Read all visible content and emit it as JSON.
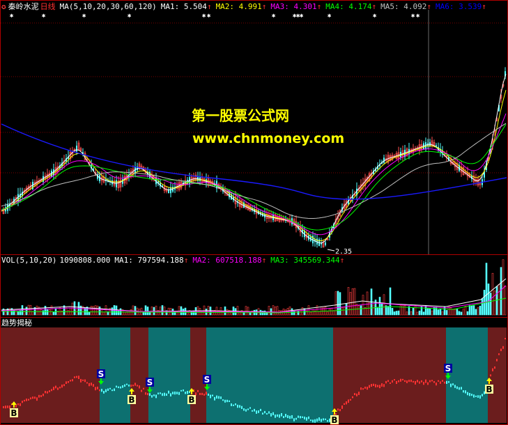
{
  "main": {
    "stock": "秦岭水泥",
    "period": "日线",
    "ma_label": "MA(5,10,20,30,60,120)",
    "values": [
      {
        "label": "MA1:",
        "value": "5.504",
        "arrow": "↑",
        "color": "#ffffff"
      },
      {
        "label": "MA2:",
        "value": "4.991",
        "arrow": "↑",
        "color": "#ffff00"
      },
      {
        "label": "MA3:",
        "value": "4.301",
        "arrow": "↑",
        "color": "#ff00ff"
      },
      {
        "label": "MA4:",
        "value": "4.174",
        "arrow": "↑",
        "color": "#00ff00"
      },
      {
        "label": "MA5:",
        "value": "4.092",
        "arrow": "↑",
        "color": "#c0c0c0"
      },
      {
        "label": "MA6:",
        "value": "3.539",
        "arrow": "↑",
        "color": "#0000ff"
      }
    ],
    "low_price": "2.35"
  },
  "watermark": {
    "line1": "第一股票公式网",
    "line2": "www.chnmoney.com"
  },
  "vol": {
    "label": "VOL(5,10,20)",
    "value": "1090808.000",
    "values": [
      {
        "label": "MA1:",
        "value": "797594.188",
        "arrow": "↑",
        "color": "#ffffff"
      },
      {
        "label": "MA2:",
        "value": "607518.188",
        "arrow": "↑",
        "color": "#ff00ff"
      },
      {
        "label": "MA3:",
        "value": "345569.344",
        "arrow": "↑",
        "color": "#00ff00"
      }
    ]
  },
  "trend": {
    "title": "趋势揭秘",
    "buy": "B",
    "sell": "S"
  },
  "colors": {
    "up": "#ff3232",
    "down": "#54ffff",
    "border": "#b00000",
    "bull_zone": "#6b1d1d",
    "bear_zone": "#0d7070"
  }
}
